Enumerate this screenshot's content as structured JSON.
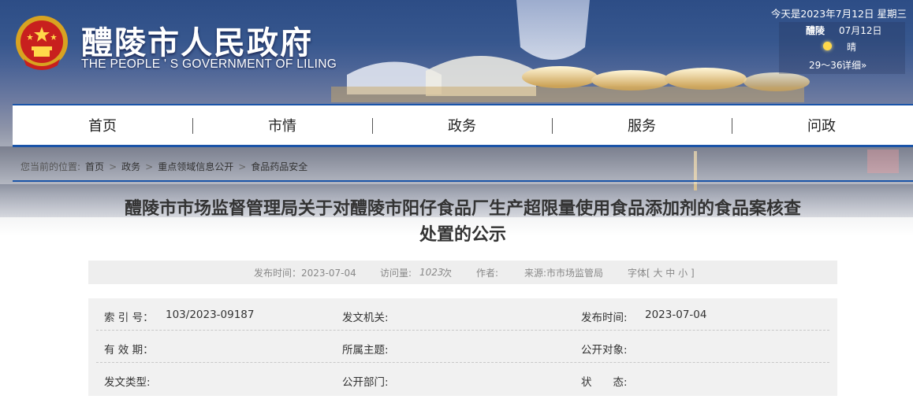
{
  "header": {
    "title": "醴陵市人民政府",
    "subtitle": "THE PEOPLE ' S GOVERNMENT OF LILING",
    "date": "今天是2023年7月12日 星期三"
  },
  "weather": {
    "city": "醴陵",
    "date": "07月12日",
    "condition": "晴",
    "temperature": "29～36",
    "more_link": "详细»"
  },
  "nav": {
    "items": [
      "首页",
      "市情",
      "政务",
      "服务",
      "问政"
    ]
  },
  "breadcrumb": {
    "prefix": "您当前的位置:",
    "items": [
      "首页",
      "政务",
      "重点领域信息公开",
      "食品药品安全"
    ],
    "separator": ">"
  },
  "article": {
    "title_line1": "醴陵市市场监督管理局关于对醴陵市阳仔食品厂生产超限量使用食品添加剂的食品案核查",
    "title_line2": "处置的公示"
  },
  "meta": {
    "publish_label": "发布时间：2023-07-04",
    "visits_label": "访问量:",
    "visits_value": "1023",
    "visits_unit": "次",
    "author_label": "作者:",
    "source_label": "来源:市市场监管局",
    "font_size_label": "字体[ 大 中 小 ]"
  },
  "info": {
    "index_label": "索 引 号：",
    "index_value": "103/2023-09187",
    "issuer_label": "发文机关:",
    "issuer_value": "",
    "pubtime_label": "发布时间:",
    "pubtime_value": "2023-07-04",
    "validity_label": "有 效 期：",
    "validity_value": "",
    "topic_label": "所属主题:",
    "topic_value": "",
    "audience_label": "公开对象:",
    "audience_value": "",
    "doctype_label": "发文类型:",
    "doctype_value": "",
    "dept_label": "公开部门:",
    "dept_value": "",
    "status_label": "状　　态:",
    "status_value": ""
  },
  "colors": {
    "accent": "#1a54a8",
    "banner_top": "#2d4d86"
  },
  "icons": [
    "national-emblem-icon",
    "sun-icon"
  ]
}
